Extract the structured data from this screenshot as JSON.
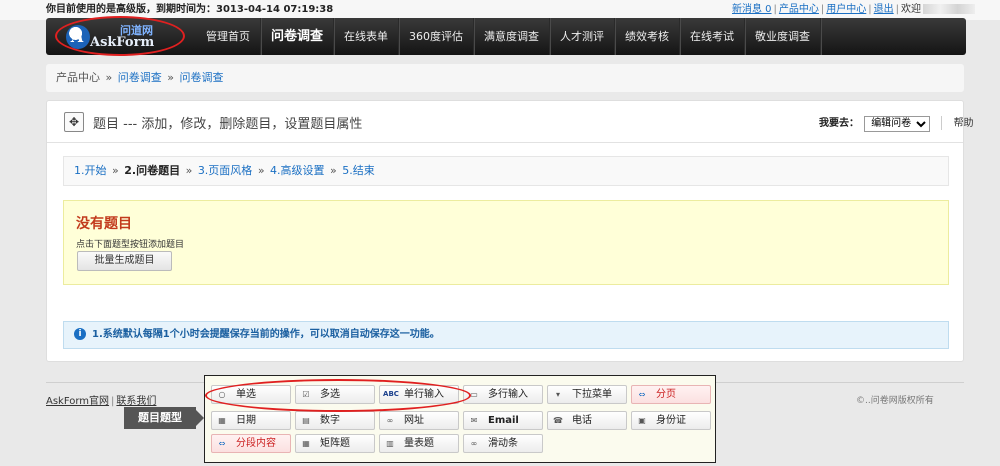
{
  "topbar": {
    "edition_text": "你目前使用的是高级版，到期时间为：3013-04-14 07:19:38",
    "new_messages": "新消息 0",
    "product_center": "产品中心",
    "user_center": "用户中心",
    "logout": "退出",
    "welcome": "欢迎"
  },
  "logo": {
    "cn": "问道网",
    "en": "AskForm",
    "letter": "A"
  },
  "nav": {
    "items": [
      {
        "label": "管理首页"
      },
      {
        "label": "问卷调查"
      },
      {
        "label": "在线表单"
      },
      {
        "label": "360度评估"
      },
      {
        "label": "满意度调查"
      },
      {
        "label": "人才测评"
      },
      {
        "label": "绩效考核"
      },
      {
        "label": "在线考试"
      },
      {
        "label": "敬业度调查"
      }
    ]
  },
  "breadcrumb": {
    "root": "产品中心",
    "level1": "问卷调查",
    "level2": "问卷调查",
    "sep": "»"
  },
  "panel": {
    "expand_icon": "✥",
    "title": "题目 --- 添加，修改，删除题目，设置题目属性",
    "goto_label": "我要去：",
    "goto_selected": "编辑问卷",
    "help": "帮助"
  },
  "steps": {
    "s1": "1.开始",
    "s2": "2.问卷题目",
    "s3": "3.页面风格",
    "s4": "4.高级设置",
    "s5": "5.结束",
    "sep": "»"
  },
  "empty": {
    "title": "没有题目",
    "hint": "点击下面题型按钮添加题目",
    "batch_button": "批量生成题目"
  },
  "info": {
    "icon": "i",
    "text": "1.系统默认每隔1个小时会提醒保存当前的操作，可以取消自动保存这一功能。"
  },
  "footer": {
    "link1": "AskForm官网",
    "link2": "联系我们",
    "sep": "|",
    "copyright": "©..问卷网版权所有"
  },
  "qtypes": {
    "label": "题目题型",
    "buttons": [
      {
        "label": "单选",
        "icon": "○"
      },
      {
        "label": "多选",
        "icon": "☑"
      },
      {
        "label": "单行输入",
        "icon": "ABC"
      },
      {
        "label": "多行输入",
        "icon": "▭"
      },
      {
        "label": "下拉菜单",
        "icon": "▾"
      },
      {
        "label": "分页",
        "icon": "⇔"
      },
      {
        "label": "日期",
        "icon": "▦"
      },
      {
        "label": "数字",
        "icon": "▤"
      },
      {
        "label": "网址",
        "icon": "∞"
      },
      {
        "label": "Email",
        "icon": "✉"
      },
      {
        "label": "电话",
        "icon": "☎"
      },
      {
        "label": "身份证",
        "icon": "▣"
      },
      {
        "label": "分段内容",
        "icon": "⇔"
      },
      {
        "label": "矩阵题",
        "icon": "▦"
      },
      {
        "label": "量表题",
        "icon": "▥"
      },
      {
        "label": "滑动条",
        "icon": "∞"
      }
    ]
  }
}
